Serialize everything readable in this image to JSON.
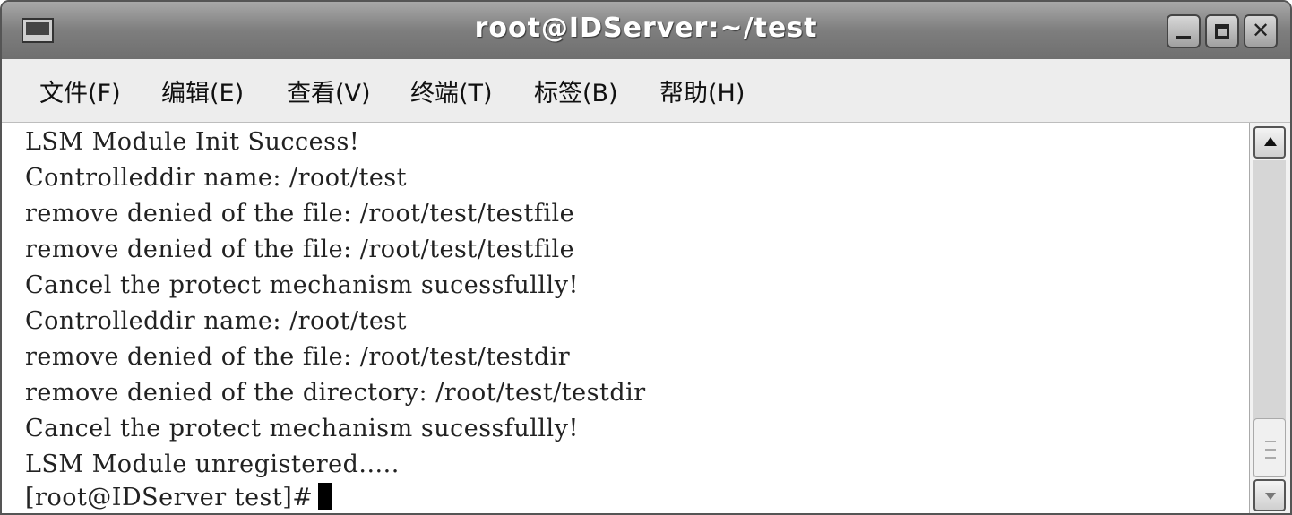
{
  "window": {
    "title": "root@IDServer:~/test",
    "icon": "terminal-icon",
    "controls": [
      "minimize-icon",
      "maximize-icon",
      "close-icon"
    ]
  },
  "menu": {
    "file": "文件(F)",
    "edit": "编辑(E)",
    "view": "查看(V)",
    "terminal": "终端(T)",
    "tabs": "标签(B)",
    "help": "帮助(H)"
  },
  "terminal": {
    "lines": [
      "LSM Module Init Success!",
      "Controlleddir name: /root/test",
      "remove denied of the file: /root/test/testfile",
      "remove denied of the file: /root/test/testfile",
      "Cancel the protect mechanism sucessfullly!",
      "Controlleddir name: /root/test",
      "remove denied of the file: /root/test/testdir",
      "remove denied of the directory: /root/test/testdir",
      "Cancel the protect mechanism sucessfullly!",
      "LSM Module unregistered.....",
      "[root@IDServer test]#"
    ]
  }
}
